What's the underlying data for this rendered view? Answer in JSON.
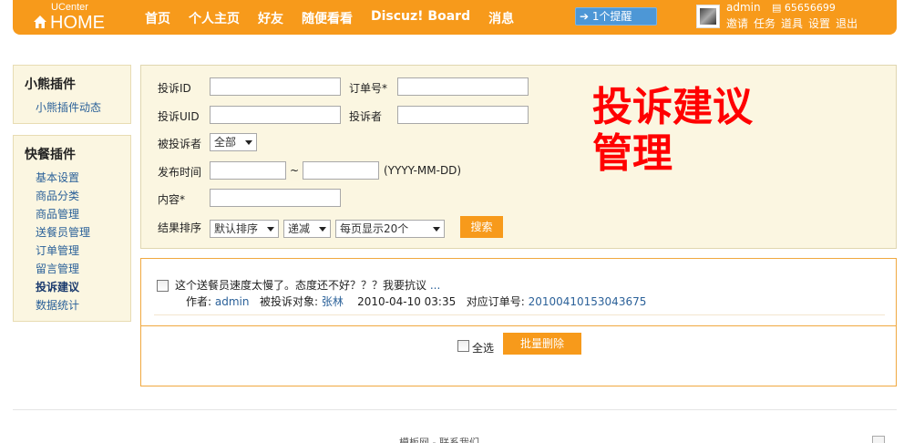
{
  "header": {
    "logo_small": "UCenter",
    "logo_main": "HOME",
    "nav": [
      "首页",
      "个人主页",
      "好友",
      "随便看看",
      "Discuz! Board",
      "消息"
    ],
    "notice": "1个提醒",
    "user_name": "admin",
    "user_score": "65656699",
    "user_links": [
      "邀请",
      "任务",
      "道具",
      "设置",
      "退出"
    ]
  },
  "sidebar": {
    "box1": {
      "title": "小熊插件",
      "items": [
        "小熊插件动态"
      ]
    },
    "box2": {
      "title": "快餐插件",
      "items": [
        "基本设置",
        "商品分类",
        "商品管理",
        "送餐员管理",
        "订单管理",
        "留言管理",
        "投诉建议",
        "数据统计"
      ],
      "active": "投诉建议"
    }
  },
  "search": {
    "labels": {
      "complaint_id": "投诉ID",
      "order_no": "订单号*",
      "complaint_uid": "投诉UID",
      "complainant": "投诉者",
      "complained": "被投诉者",
      "publish_time": "发布时间",
      "date_sep": "~",
      "date_format": "(YYYY-MM-DD)",
      "content": "内容*",
      "sort": "结果排序"
    },
    "complained_select": "全部",
    "sort_select": "默认排序",
    "order_select": "递减",
    "page_select": "每页显示20个",
    "search_button": "搜索",
    "big_title_line1": "投诉建议",
    "big_title_line2": "管理"
  },
  "results": {
    "items": [
      {
        "text": "这个送餐员速度太慢了。态度还不好？？？我要抗议",
        "more": "...",
        "author_label": "作者:",
        "author": "admin",
        "target_label": "被投诉对象:",
        "target": "张林",
        "time": "2010-04-10 03:35",
        "order_label": "对应订单号:",
        "order": "20100410153043675"
      }
    ],
    "select_all": "全选",
    "batch_delete": "批量删除"
  },
  "footer": {
    "text": "模板网 - 联系我们"
  },
  "colors": {
    "accent": "#f79a1b",
    "panel_bg": "#fbf6e1",
    "link": "#2b6199",
    "title_red": "#ff0000"
  }
}
